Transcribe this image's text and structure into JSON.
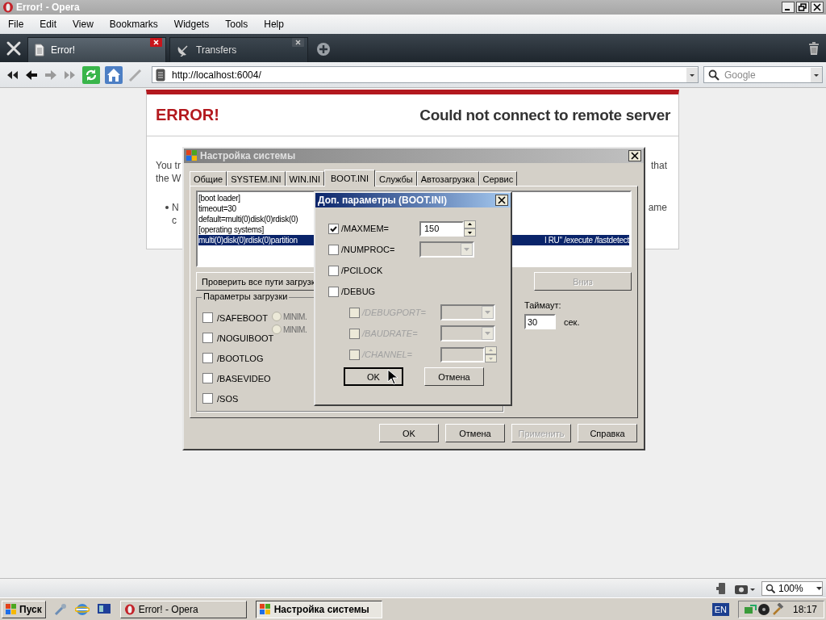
{
  "window": {
    "title": "Error! - Opera"
  },
  "menu": [
    "File",
    "Edit",
    "View",
    "Bookmarks",
    "Widgets",
    "Tools",
    "Help"
  ],
  "tabs": [
    {
      "label": "Error!",
      "selected": true
    },
    {
      "label": "Transfers",
      "selected": false
    }
  ],
  "address": {
    "value": "http://localhost:6004/"
  },
  "search": {
    "placeholder": "Google"
  },
  "page": {
    "heading": "ERROR!",
    "subheading": "Could not connect to remote server",
    "lines": [
      {
        "kind": "text",
        "left": "You tr",
        "right": "that"
      },
      {
        "kind": "text",
        "left": "the W"
      },
      {
        "kind": "bullet",
        "left": "N",
        "right": "ame"
      },
      {
        "kind": "indent",
        "left": "c"
      }
    ]
  },
  "sysconfig": {
    "title": "Настройка системы",
    "tabs": [
      {
        "label": "Общие",
        "selected": false
      },
      {
        "label": "SYSTEM.INI",
        "selected": false
      },
      {
        "label": "WIN.INI",
        "selected": false
      },
      {
        "label": "BOOT.INI",
        "selected": true
      },
      {
        "label": "Службы",
        "selected": false
      },
      {
        "label": "Автозагрузка",
        "selected": false
      },
      {
        "label": "Сервис",
        "selected": false
      }
    ],
    "boot_lines": [
      {
        "text": "[boot loader]",
        "selected": false
      },
      {
        "text": "timeout=30",
        "selected": false
      },
      {
        "text": "default=multi(0)disk(0)rdisk(0)",
        "selected": false
      },
      {
        "text": "[operating systems]",
        "selected": false
      },
      {
        "text": "multi(0)disk(0)rdisk(0)partition",
        "tail": "l RU\" /execute /fastdetect",
        "selected": true
      }
    ],
    "check_paths_button": "Проверить все пути загрузк",
    "down_button": {
      "label": "Вниз",
      "disabled": true
    },
    "boot_options": {
      "title": "Параметры загрузки",
      "checks": [
        {
          "label": "/SAFEBOOT",
          "checked": false
        },
        {
          "label": "/NOGUIBOOT",
          "checked": false
        },
        {
          "label": "/BOOTLOG",
          "checked": false
        },
        {
          "label": "/BASEVIDEO",
          "checked": false
        },
        {
          "label": "/SOS",
          "checked": false
        }
      ],
      "radios": [
        {
          "label": "MINIM.",
          "selected": false,
          "disabled": true
        },
        {
          "label": "MINIM.",
          "selected": false,
          "disabled": true
        }
      ]
    },
    "timeout": {
      "label": "Таймаут:",
      "value": "30",
      "unit": "сек."
    },
    "buttons": [
      {
        "label": "OK",
        "disabled": false
      },
      {
        "label": "Отмена",
        "disabled": false
      },
      {
        "label": "Применить",
        "disabled": true
      },
      {
        "label": "Справка",
        "disabled": false
      }
    ]
  },
  "advanced": {
    "title": "Доп. параметры (BOOT.INI)",
    "options": [
      {
        "kind": "spin",
        "label": "/MAXMEM=",
        "checked": true,
        "disabled": false,
        "value": "150"
      },
      {
        "kind": "combo",
        "label": "/NUMPROC=",
        "checked": false,
        "disabled": false
      },
      {
        "kind": "plain",
        "label": "/PCILOCK",
        "checked": false,
        "disabled": false
      },
      {
        "kind": "plain",
        "label": "/DEBUG",
        "checked": false,
        "disabled": false,
        "children": [
          {
            "kind": "combo",
            "label": "/DEBUGPORT=",
            "checked": false,
            "disabled": true
          },
          {
            "kind": "combo",
            "label": "/BAUDRATE=",
            "checked": false,
            "disabled": true
          },
          {
            "kind": "spin",
            "label": "/CHANNEL=",
            "checked": false,
            "disabled": true
          }
        ]
      }
    ],
    "buttons": [
      {
        "label": "OK",
        "default": true
      },
      {
        "label": "Отмена",
        "default": false
      }
    ]
  },
  "status_bar": {
    "zoom": "100%"
  },
  "taskbar": {
    "start": "Пуск",
    "tasks": [
      {
        "label": "Error! - Opera",
        "selected": false
      },
      {
        "label": "Настройка системы",
        "selected": true
      }
    ],
    "language": "EN",
    "clock": "18:17"
  }
}
